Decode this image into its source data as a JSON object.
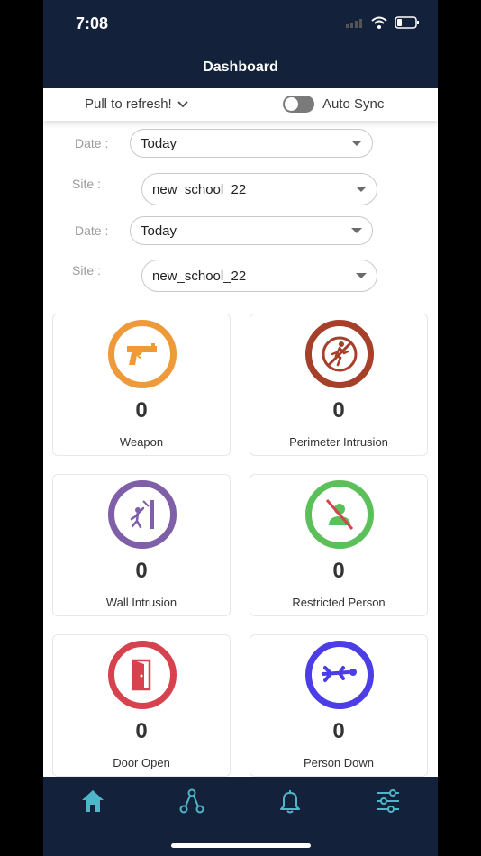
{
  "status": {
    "time": "7:08"
  },
  "header": {
    "title": "Dashboard"
  },
  "sync": {
    "pull_label": "Pull to refresh!",
    "auto_sync_label": "Auto Sync",
    "auto_sync_on": false
  },
  "filters": [
    {
      "date_label": "Date :",
      "date_value": "Today",
      "site_label": "Site :",
      "site_value": "new_school_22"
    },
    {
      "date_label": "Date :",
      "date_value": "Today",
      "site_label": "Site :",
      "site_value": "new_school_22"
    }
  ],
  "cards": [
    {
      "label": "Weapon",
      "count": "0",
      "color": "#ee9a3a",
      "icon": "gun-icon"
    },
    {
      "label": "Perimeter Intrusion",
      "count": "0",
      "color": "#a6402b",
      "icon": "no-entry-person-icon"
    },
    {
      "label": "Wall Intrusion",
      "count": "0",
      "color": "#7e5fa8",
      "icon": "climbing-wall-icon"
    },
    {
      "label": "Restricted Person",
      "count": "0",
      "color": "#5cc05a",
      "icon": "restricted-person-icon"
    },
    {
      "label": "Door Open",
      "count": "0",
      "color": "#d6434f",
      "icon": "open-door-icon"
    },
    {
      "label": "Person Down",
      "count": "0",
      "color": "#4c3ee6",
      "icon": "person-down-icon"
    }
  ],
  "tabs": [
    {
      "name": "home",
      "icon": "home-icon",
      "active": true
    },
    {
      "name": "network",
      "icon": "network-icon",
      "active": false
    },
    {
      "name": "alerts",
      "icon": "bell-icon",
      "active": false
    },
    {
      "name": "settings",
      "icon": "sliders-icon",
      "active": false
    }
  ],
  "colors": {
    "nav_bg": "#13213a",
    "tab_icon": "#4fb6c9"
  }
}
